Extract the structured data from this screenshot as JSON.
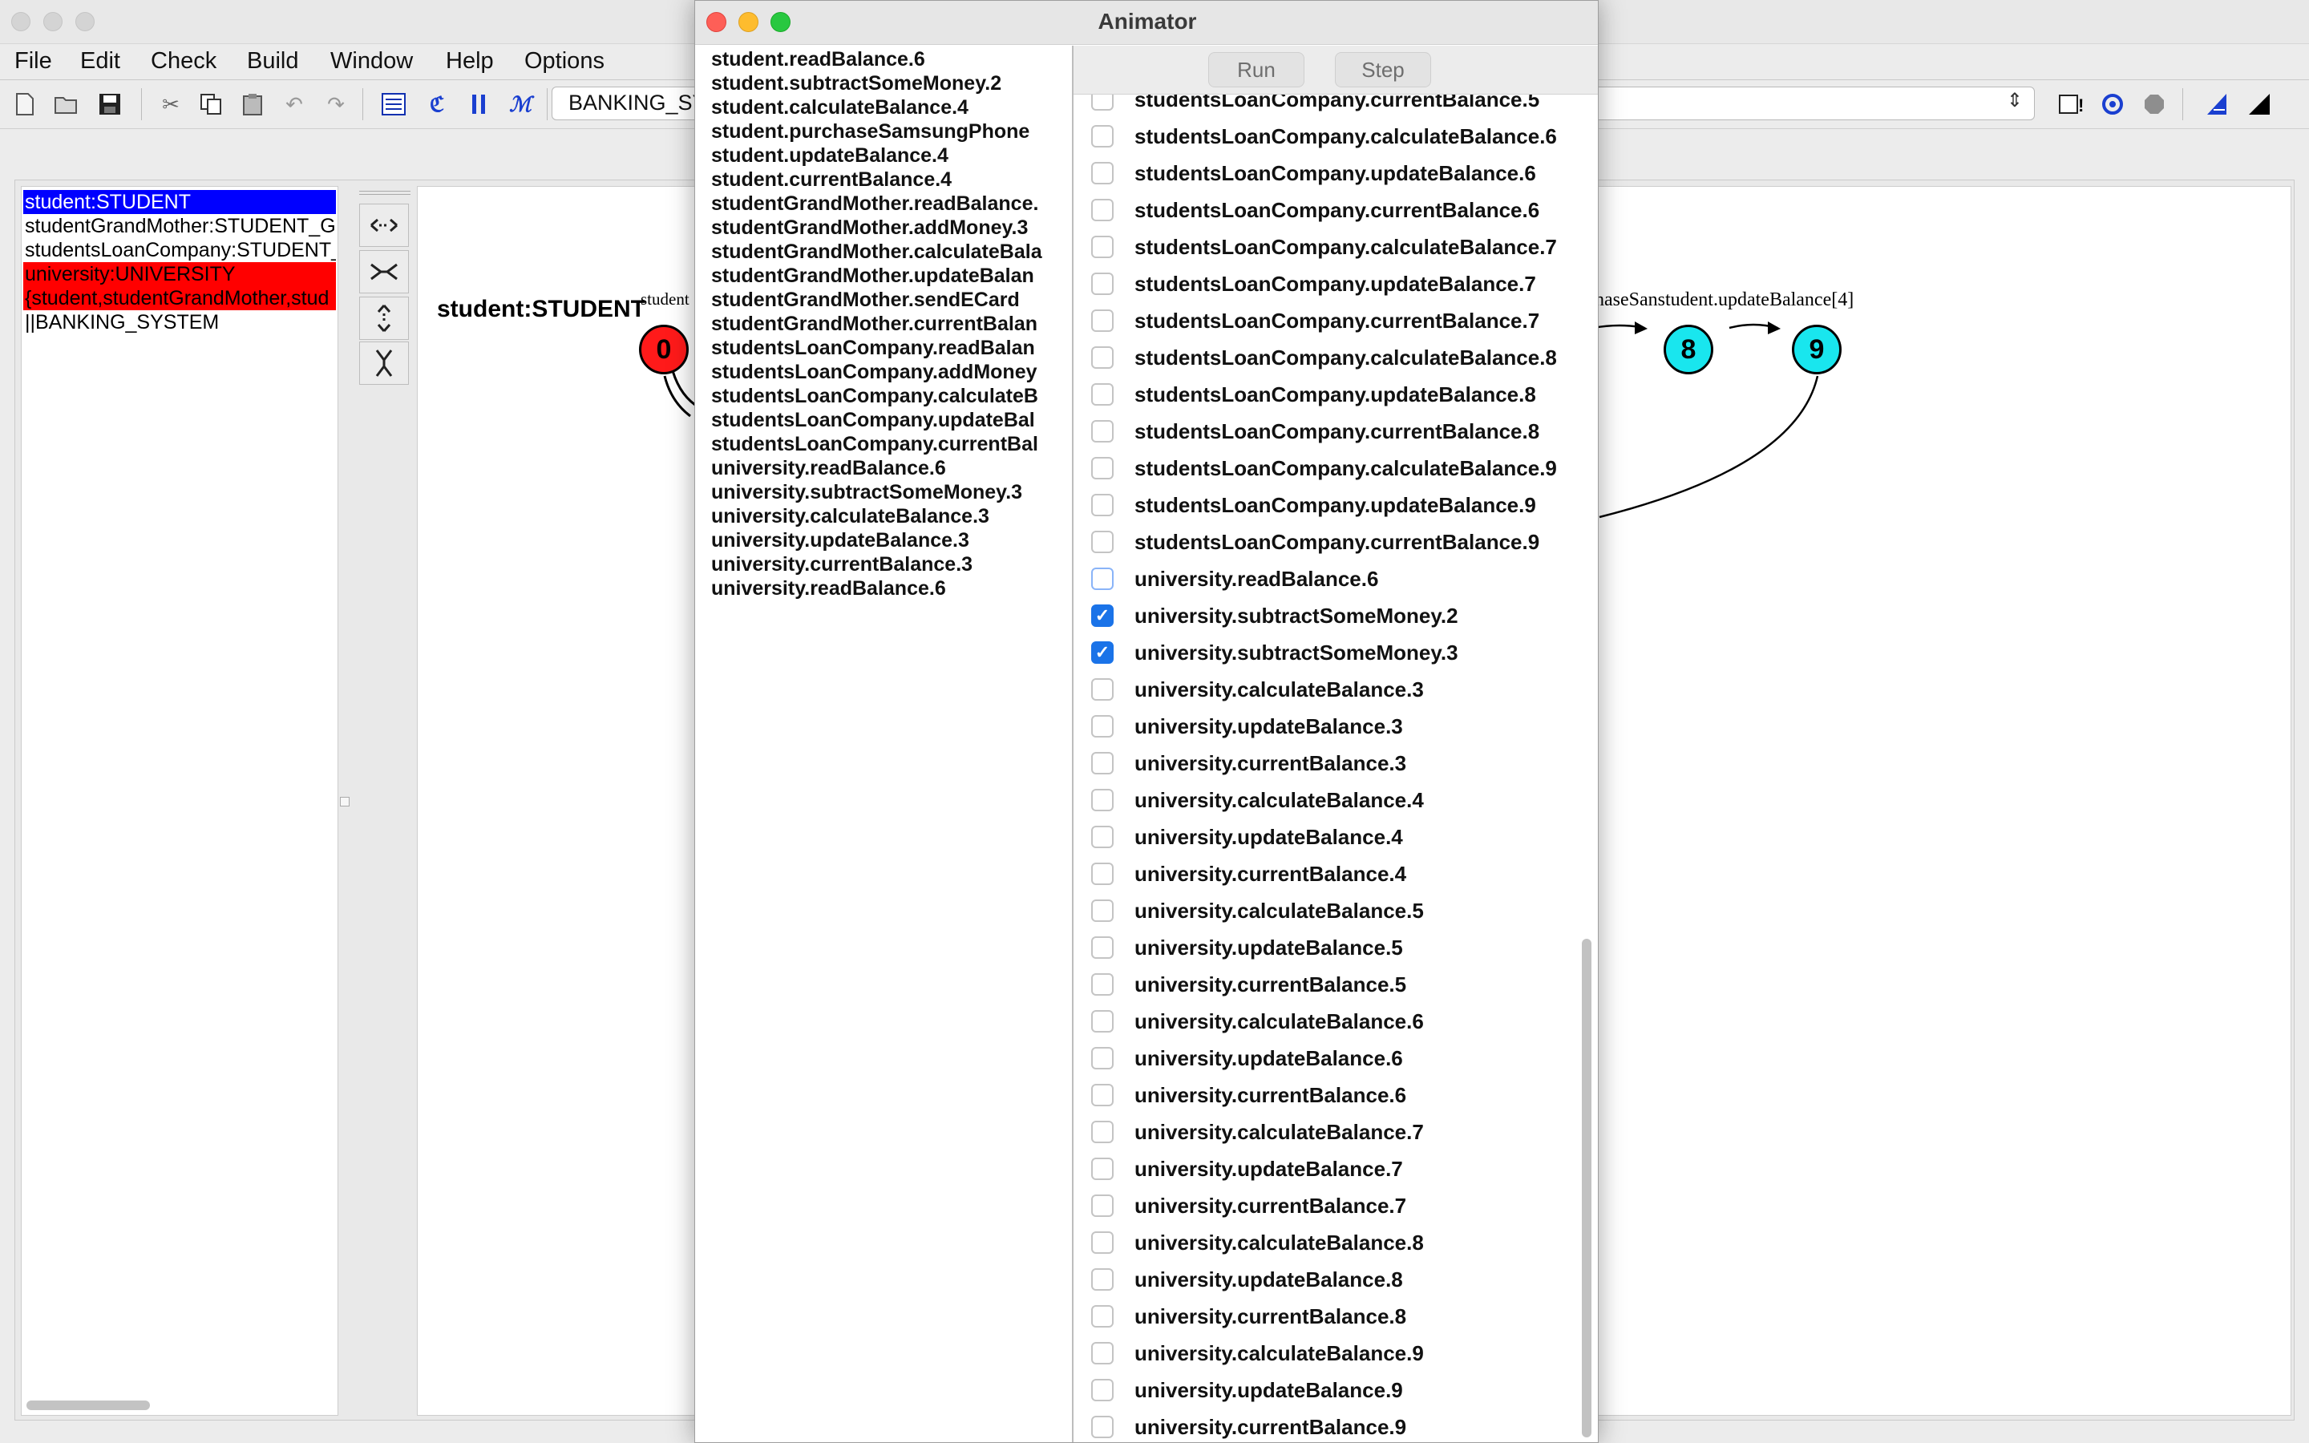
{
  "menu": [
    "File",
    "Edit",
    "Check",
    "Build",
    "Window",
    "Help",
    "Options"
  ],
  "toolbar": {
    "target_combo": "BANKING_SYSTEM",
    "target_visible": "BANKING_SY"
  },
  "processes": [
    {
      "label": "student:STUDENT",
      "state": "selected"
    },
    {
      "label": "studentGrandMother:STUDENT_G",
      "state": "normal"
    },
    {
      "label": "studentsLoanCompany:STUDENT_",
      "state": "normal"
    },
    {
      "label": "university:UNIVERSITY",
      "state": "error"
    },
    {
      "label": "{student,studentGrandMother,stud",
      "state": "error"
    },
    {
      "label": "||BANKING_SYSTEM",
      "state": "normal"
    }
  ],
  "canvas": {
    "process_title": "student:STUDENT",
    "edge_label_left": "student",
    "edge_label_right": "haseSanstudent.updateBalance[4]",
    "states": [
      {
        "id": "0",
        "color": "#ff1a1a"
      },
      {
        "id": "8",
        "color": "#19e6ee"
      },
      {
        "id": "9",
        "color": "#19e6ee"
      }
    ]
  },
  "animator": {
    "title": "Animator",
    "run_label": "Run",
    "step_label": "Step",
    "trace": [
      "student.readBalance.6",
      "student.subtractSomeMoney.2",
      "student.calculateBalance.4",
      "student.purchaseSamsungPhone",
      "student.updateBalance.4",
      "student.currentBalance.4",
      "studentGrandMother.readBalance.",
      "studentGrandMother.addMoney.3",
      "studentGrandMother.calculateBala",
      "studentGrandMother.updateBalan",
      "studentGrandMother.sendECard",
      "studentGrandMother.currentBalan",
      "studentsLoanCompany.readBalan",
      "studentsLoanCompany.addMoney",
      "studentsLoanCompany.calculateB",
      "studentsLoanCompany.updateBal",
      "studentsLoanCompany.currentBal",
      "university.readBalance.6",
      "university.subtractSomeMoney.3",
      "university.calculateBalance.3",
      "university.updateBalance.3",
      "university.currentBalance.3",
      "university.readBalance.6"
    ],
    "actions": [
      {
        "label": "studentsLoanCompany.currentBalance.5",
        "checked": false
      },
      {
        "label": "studentsLoanCompany.calculateBalance.6",
        "checked": false
      },
      {
        "label": "studentsLoanCompany.updateBalance.6",
        "checked": false
      },
      {
        "label": "studentsLoanCompany.currentBalance.6",
        "checked": false
      },
      {
        "label": "studentsLoanCompany.calculateBalance.7",
        "checked": false
      },
      {
        "label": "studentsLoanCompany.updateBalance.7",
        "checked": false
      },
      {
        "label": "studentsLoanCompany.currentBalance.7",
        "checked": false
      },
      {
        "label": "studentsLoanCompany.calculateBalance.8",
        "checked": false
      },
      {
        "label": "studentsLoanCompany.updateBalance.8",
        "checked": false
      },
      {
        "label": "studentsLoanCompany.currentBalance.8",
        "checked": false
      },
      {
        "label": "studentsLoanCompany.calculateBalance.9",
        "checked": false
      },
      {
        "label": "studentsLoanCompany.updateBalance.9",
        "checked": false
      },
      {
        "label": "studentsLoanCompany.currentBalance.9",
        "checked": false
      },
      {
        "label": "university.readBalance.6",
        "checked": false,
        "focus": true
      },
      {
        "label": "university.subtractSomeMoney.2",
        "checked": true
      },
      {
        "label": "university.subtractSomeMoney.3",
        "checked": true
      },
      {
        "label": "university.calculateBalance.3",
        "checked": false
      },
      {
        "label": "university.updateBalance.3",
        "checked": false
      },
      {
        "label": "university.currentBalance.3",
        "checked": false
      },
      {
        "label": "university.calculateBalance.4",
        "checked": false
      },
      {
        "label": "university.updateBalance.4",
        "checked": false
      },
      {
        "label": "university.currentBalance.4",
        "checked": false
      },
      {
        "label": "university.calculateBalance.5",
        "checked": false
      },
      {
        "label": "university.updateBalance.5",
        "checked": false
      },
      {
        "label": "university.currentBalance.5",
        "checked": false
      },
      {
        "label": "university.calculateBalance.6",
        "checked": false
      },
      {
        "label": "university.updateBalance.6",
        "checked": false
      },
      {
        "label": "university.currentBalance.6",
        "checked": false
      },
      {
        "label": "university.calculateBalance.7",
        "checked": false
      },
      {
        "label": "university.updateBalance.7",
        "checked": false
      },
      {
        "label": "university.currentBalance.7",
        "checked": false
      },
      {
        "label": "university.calculateBalance.8",
        "checked": false
      },
      {
        "label": "university.updateBalance.8",
        "checked": false
      },
      {
        "label": "university.currentBalance.8",
        "checked": false
      },
      {
        "label": "university.calculateBalance.9",
        "checked": false
      },
      {
        "label": "university.updateBalance.9",
        "checked": false
      },
      {
        "label": "university.currentBalance.9",
        "checked": false
      }
    ]
  },
  "colors": {
    "selected": "#0000ff",
    "error": "#ff0000",
    "checkbox_blue": "#1a73e8"
  }
}
